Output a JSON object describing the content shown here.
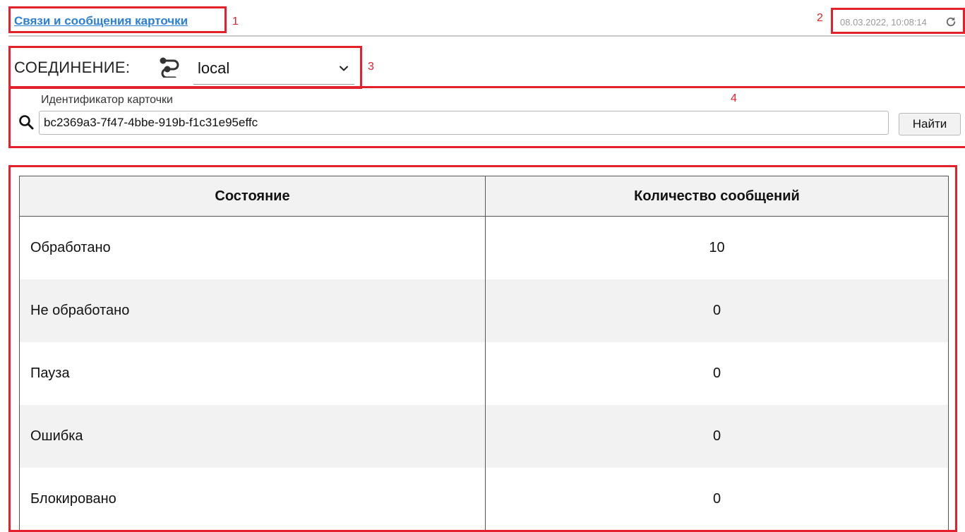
{
  "header": {
    "title": "Связи и сообщения карточки",
    "timestamp": "08.03.2022, 10:08:14"
  },
  "connection": {
    "label": "СОЕДИНЕНИЕ:",
    "value": "local"
  },
  "search": {
    "label": "Идентификатор карточки",
    "value": "bc2369a3-7f47-4bbe-919b-f1c31e95effc",
    "button_label": "Найти"
  },
  "table": {
    "headers": [
      "Состояние",
      "Количество сообщений"
    ],
    "rows": [
      {
        "state": "Обработано",
        "count": "10"
      },
      {
        "state": "Не обработано",
        "count": "0"
      },
      {
        "state": "Пауза",
        "count": "0"
      },
      {
        "state": "Ошибка",
        "count": "0"
      },
      {
        "state": "Блокировано",
        "count": "0"
      }
    ]
  },
  "annotations": {
    "m1": "1",
    "m2": "2",
    "m3": "3",
    "m4": "4"
  },
  "colors": {
    "link": "#2a7fd6",
    "highlight": "#e3202b"
  },
  "icons": [
    "refresh-icon",
    "connection-icon",
    "chevron-down-icon",
    "search-icon"
  ]
}
